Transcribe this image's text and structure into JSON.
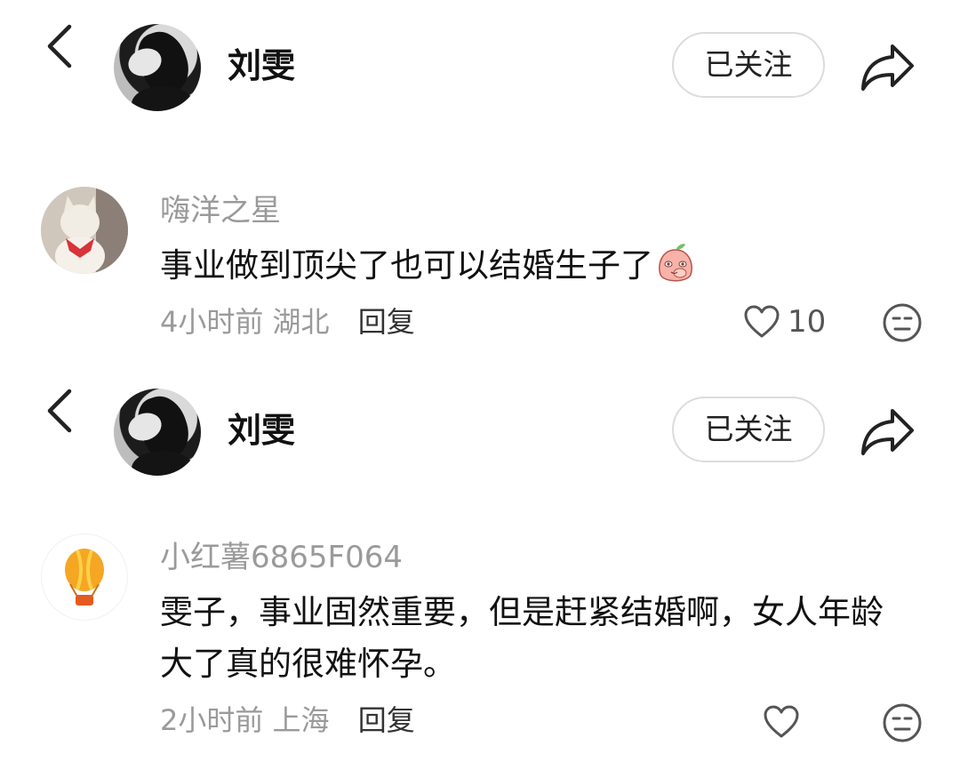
{
  "header1": {
    "name": "刘雯",
    "follow_label": "已关注"
  },
  "comment1": {
    "username": "嗨洋之星",
    "text": "事业做到顶尖了也可以结婚生子了",
    "time": "4小时前",
    "location": "湖北",
    "reply_label": "回复",
    "like_count": "10"
  },
  "header2": {
    "name": "刘雯",
    "follow_label": "已关注"
  },
  "comment2": {
    "username": "小红薯6865F064",
    "text": "雯子，事业固然重要，但是赶紧结婚啊，女人年龄大了真的很难怀孕。",
    "time": "2小时前",
    "location": "上海",
    "reply_label": "回复"
  },
  "icons": {
    "back": "chevron-left-icon",
    "share": "share-arrow-icon",
    "like": "heart-outline-icon",
    "dislike": "meh-face-icon",
    "emoji": "peach-shy-emoji"
  }
}
